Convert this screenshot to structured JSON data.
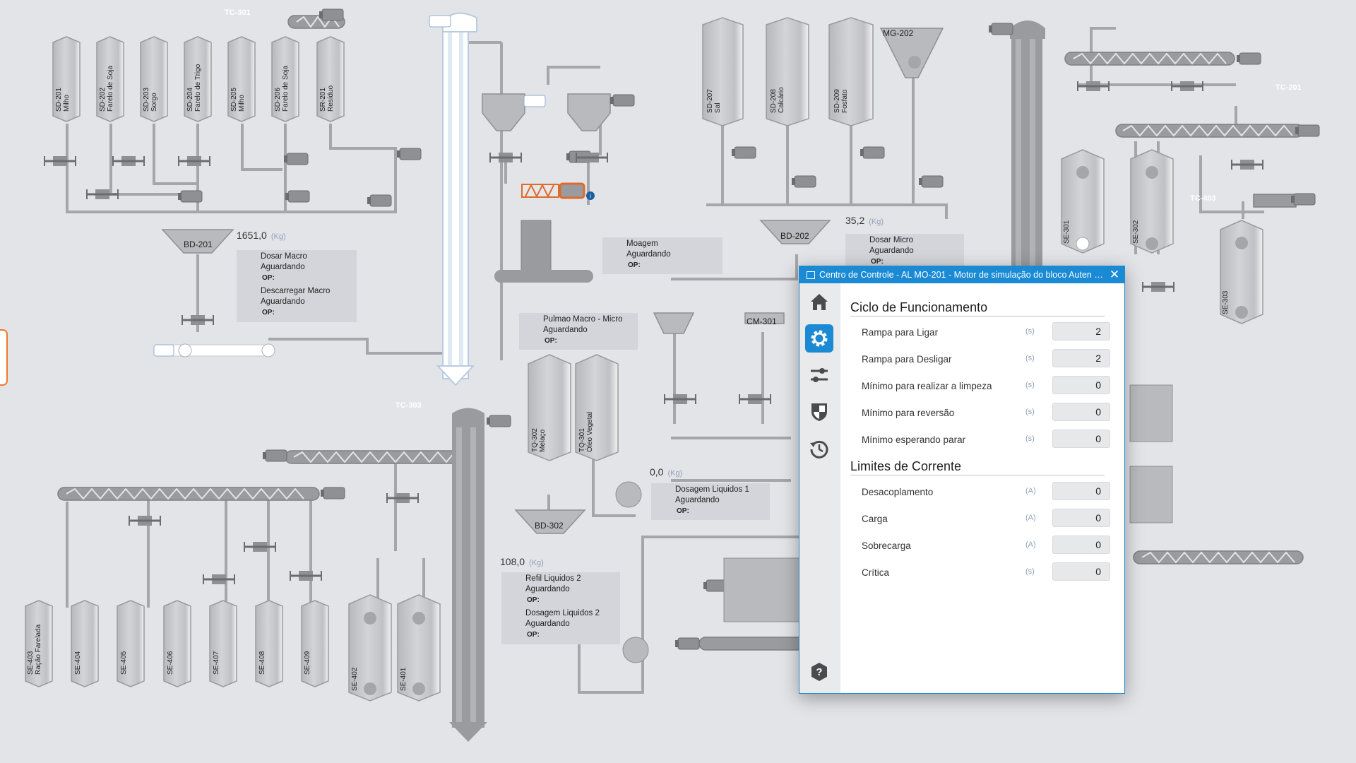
{
  "plant": {
    "conveyors": {
      "tc301_top": "TC-301",
      "tc201_right": "TC-201",
      "tc303": "TC-303",
      "tc403": "TC-403"
    },
    "silos_top_left": [
      {
        "id": "SD-201",
        "name": "Milho"
      },
      {
        "id": "SD-202",
        "name": "Farelo de Soja"
      },
      {
        "id": "SD-203",
        "name": "Sorgo"
      },
      {
        "id": "SD-204",
        "name": "Farelo de Trigo"
      },
      {
        "id": "SD-205",
        "name": "Milho"
      },
      {
        "id": "SD-206",
        "name": "Farelo de Soja"
      },
      {
        "id": "SR-201",
        "name": "Resíduo"
      }
    ],
    "silos_micro": [
      {
        "id": "SD-207",
        "name": "Sal"
      },
      {
        "id": "SD-208",
        "name": "Calcário"
      },
      {
        "id": "SD-209",
        "name": "Fosfato"
      }
    ],
    "mixer_top": "MG-202",
    "bd201": {
      "label": "BD-201",
      "value": "1651,0",
      "unit": "(Kg)"
    },
    "bd202": {
      "label": "BD-202",
      "value": "35,2",
      "unit": "(Kg)"
    },
    "bd302": {
      "label": "BD-302",
      "value": "108,0",
      "unit": "(Kg)"
    },
    "cm301": "CM-301",
    "liquid_flow": {
      "value": "0,0",
      "unit": "(Kg)"
    },
    "tanks": [
      {
        "id": "TQ-302",
        "name": "Melaço"
      },
      {
        "id": "TQ-301",
        "name": "Óleo Vegetal"
      }
    ],
    "silos_bottom": [
      {
        "id": "SE-403",
        "name": "Ração Farelada"
      },
      {
        "id": "SE-404",
        "name": ""
      },
      {
        "id": "SE-405",
        "name": ""
      },
      {
        "id": "SE-406",
        "name": ""
      },
      {
        "id": "SE-407",
        "name": ""
      },
      {
        "id": "SE-408",
        "name": ""
      },
      {
        "id": "SE-409",
        "name": ""
      },
      {
        "id": "SE-402",
        "name": ""
      },
      {
        "id": "SE-401",
        "name": ""
      }
    ],
    "silos_right": [
      {
        "id": "SE-301"
      },
      {
        "id": "SE-302"
      },
      {
        "id": "SE-303"
      }
    ],
    "status_boxes": {
      "dosar_macro": {
        "title": "Dosar Macro",
        "state": "Aguardando",
        "op": "OP:"
      },
      "descarregar_macro": {
        "title": "Descarregar Macro",
        "state": "Aguardando",
        "op": "OP:"
      },
      "moagem": {
        "title": "Moagem",
        "state": "Aguardando",
        "op": "OP:"
      },
      "dosar_micro": {
        "title": "Dosar Micro",
        "state": "Aguardando",
        "op": "OP:"
      },
      "pulmao": {
        "title": "Pulmao Macro - Micro",
        "state": "Aguardando",
        "op": "OP:"
      },
      "dosagem_liq1": {
        "title": "Dosagem Liquidos 1",
        "state": "Aguardando",
        "op": "OP:"
      },
      "refil_liq2": {
        "title": "Refil Liquidos 2",
        "state": "Aguardando",
        "op": "OP:"
      },
      "dosagem_liq2": {
        "title": "Dosagem Liquidos 2",
        "state": "Aguardando",
        "op": "OP:"
      }
    }
  },
  "dialog": {
    "title": "Centro de Controle - AL MO-201 - Motor de simulação do bloco Auten d...",
    "close": "✕",
    "nav": [
      "home-icon",
      "gear-icon",
      "sliders-icon",
      "shield-icon",
      "history-icon",
      "help-icon"
    ],
    "section1": {
      "title": "Ciclo de Funcionamento",
      "rows": [
        {
          "label": "Rampa para Ligar",
          "unit": "(s)",
          "value": "2"
        },
        {
          "label": "Rampa para Desligar",
          "unit": "(s)",
          "value": "2"
        },
        {
          "label": "Mínimo para realizar a limpeza",
          "unit": "(s)",
          "value": "0"
        },
        {
          "label": "Mínimo para reversão",
          "unit": "(s)",
          "value": "0"
        },
        {
          "label": "Mínimo esperando parar",
          "unit": "(s)",
          "value": "0"
        }
      ]
    },
    "section2": {
      "title": "Limites de Corrente",
      "rows": [
        {
          "label": "Desacoplamento",
          "unit": "(A)",
          "value": "0"
        },
        {
          "label": "Carga",
          "unit": "(A)",
          "value": "0"
        },
        {
          "label": "Sobrecarga",
          "unit": "(A)",
          "value": "0"
        },
        {
          "label": "Crítica",
          "unit": "(s)",
          "value": "0"
        }
      ]
    }
  },
  "colors": {
    "accent": "#1a8ad4",
    "equipment": "#9a9b9e",
    "pipe": "#a5a6a9",
    "alert": "#e06a2a"
  }
}
